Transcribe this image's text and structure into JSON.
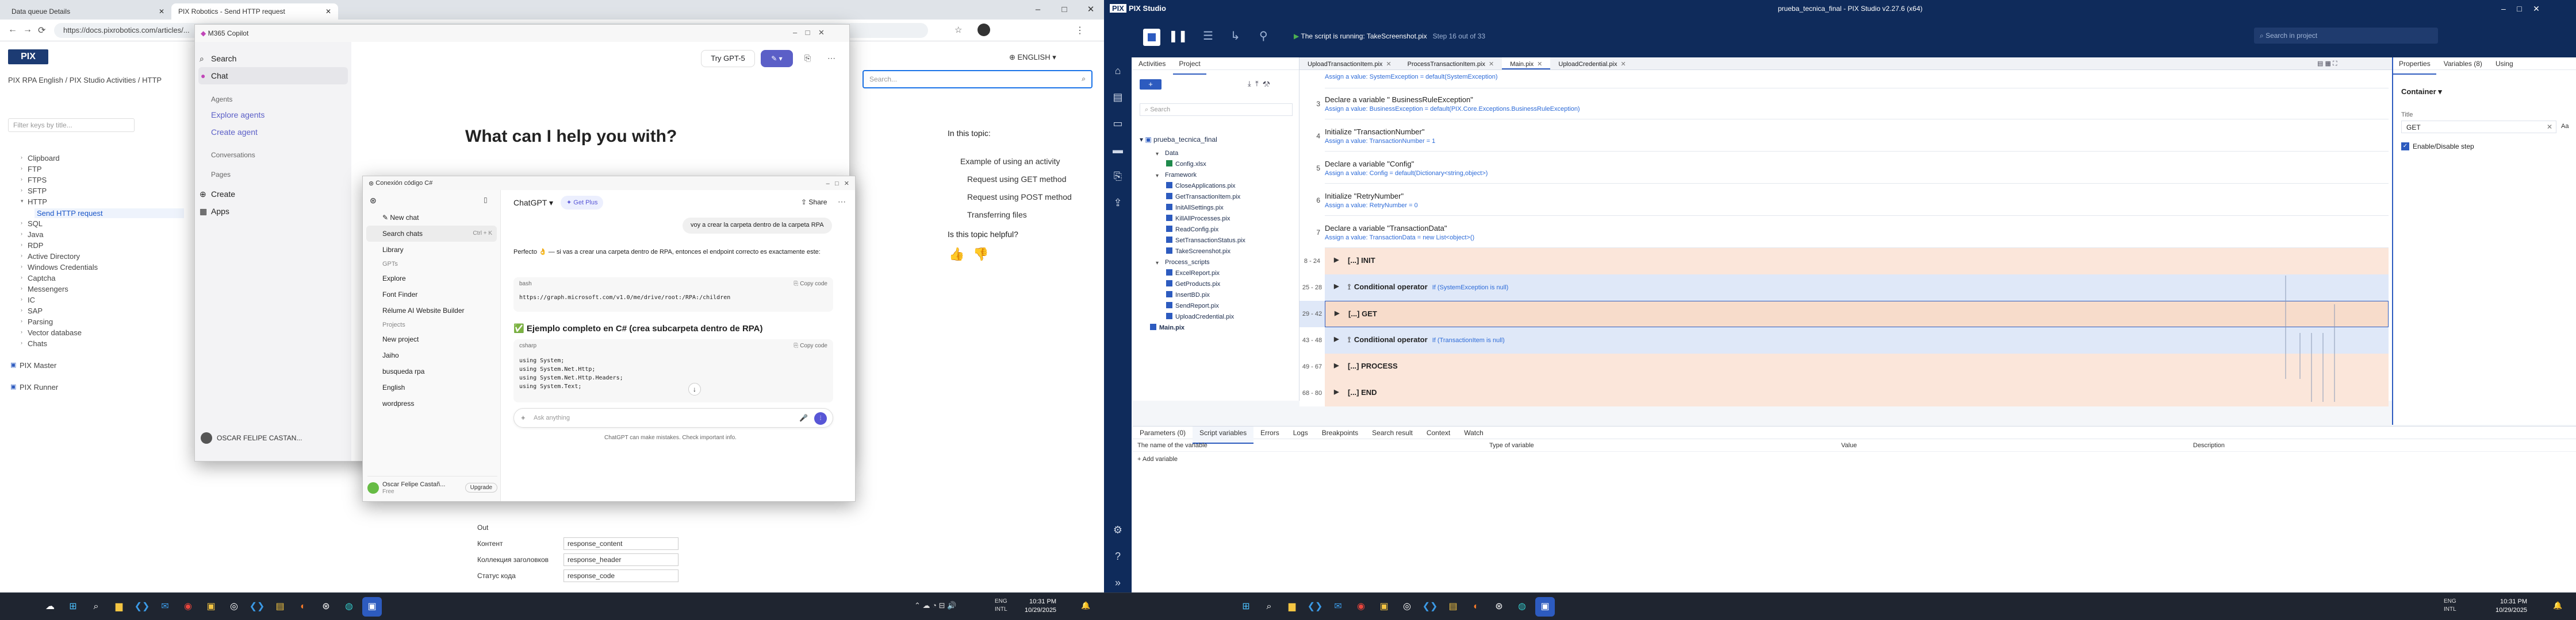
{
  "browser": {
    "tabs": [
      {
        "label": "Data queue Details"
      },
      {
        "label": "PIX Robotics - Send HTTP request"
      }
    ],
    "url": "https://docs.pixrobotics.com/articles/...",
    "window_controls": [
      "–",
      "□",
      "✕"
    ]
  },
  "docs": {
    "breadcrumb": "PIX RPA English / PIX Studio Activities / HTTP",
    "filter_placeholder": "Filter keys by title...",
    "nav_items": [
      "Clipboard",
      "FTP",
      "FTPS",
      "SFTP",
      "HTTP",
      "Send HTTP request",
      "SQL",
      "Java",
      "RDP",
      "Active Directory",
      "Windows Credentials",
      "Captcha",
      "Messengers",
      "IC",
      "SAP",
      "Parsing",
      "Vector database",
      "Chats",
      "PIX Master",
      "PIX Runner"
    ],
    "language": "ENGLISH",
    "search_placeholder": "Search...",
    "topics_title": "In this topic:",
    "topics": [
      "Example of using an activity",
      "Request using GET method",
      "Request using POST method",
      "Transferring files"
    ],
    "helpful": "Is this topic helpful?",
    "props": [
      {
        "label": "Out",
        "value": ""
      },
      {
        "label": "Контент",
        "value": "response_content"
      },
      {
        "label": "Коллекция заголовков",
        "value": "response_header"
      },
      {
        "label": "Статус кода",
        "value": "response_code"
      }
    ]
  },
  "copilot": {
    "title": "M365 Copilot",
    "menu": [
      "Search",
      "Chat",
      "Agents",
      "Explore agents",
      "Create agent",
      "Conversations",
      "Pages",
      "Create",
      "Apps"
    ],
    "try_button": "Try GPT-5",
    "heading": "What can I help you with?",
    "user": "OSCAR FELIPE CASTAN..."
  },
  "chatgpt": {
    "window_title": "Conexión código C#",
    "model": "ChatGPT",
    "plus": "Get Plus",
    "share": "Share",
    "side": [
      "New chat",
      "Search chats",
      "Library",
      "GPTs",
      "Explore",
      "Font Finder",
      "Rélume AI Website Builder",
      "Projects",
      "New project",
      "Jaiho",
      "busqueda rpa",
      "English",
      "wordpress"
    ],
    "search_hint": "Ctrl + K",
    "user_name": "Oscar Felipe Castañ...",
    "user_plan": "Free",
    "upgrade": "Upgrade",
    "user_msg": "voy a crear la carpeta dentro de la carpeta RPA",
    "reply_1": "Perfecto 👌 — si vas a crear una carpeta dentro de RPA, entonces el endpoint correcto es exactamente este:",
    "code_lang_1": "bash",
    "copy": "Copy code",
    "code_1": "https://graph.microsoft.com/v1.0/me/drive/root:/RPA:/children",
    "section": "✅ Ejemplo completo en C# (crea subcarpeta dentro de RPA)",
    "code_lang_2": "csharp",
    "code_2": [
      "using System;",
      "using System.Net.Http;",
      "using System.Net.Http.Headers;",
      "using System.Text;"
    ],
    "placeholder": "Ask anything",
    "disclaimer": "ChatGPT can make mistakes. Check important info."
  },
  "taskbar_left": {
    "time": "10:31 PM",
    "date": "10/29/2025",
    "lang": "ENG INTL"
  },
  "pix": {
    "app_title": "prueba_tecnica_final - PIX Studio v2.27.6 (x64)",
    "brand": "PIX Studio",
    "status": "The script is running: TakeScreenshot.pix",
    "step": "Step 16 out of 33",
    "search_project": "Search in project",
    "panel_tabs": [
      "Activities",
      "Project"
    ],
    "search": "Search",
    "project_name": "prueba_tecnica_final",
    "tree": [
      {
        "name": "Data",
        "kind": "folder"
      },
      {
        "name": "Config.xlsx",
        "kind": "xlsx"
      },
      {
        "name": "Framework",
        "kind": "folder"
      },
      {
        "name": "CloseApplications.pix",
        "kind": "pix"
      },
      {
        "name": "GetTransactionItem.pix",
        "kind": "pix"
      },
      {
        "name": "InitAllSettings.pix",
        "kind": "pix"
      },
      {
        "name": "KillAllProcesses.pix",
        "kind": "pix"
      },
      {
        "name": "ReadConfig.pix",
        "kind": "pix"
      },
      {
        "name": "SetTransactionStatus.pix",
        "kind": "pix"
      },
      {
        "name": "TakeScreenshot.pix",
        "kind": "pix"
      },
      {
        "name": "Process_scripts",
        "kind": "folder"
      },
      {
        "name": "ExcelReport.pix",
        "kind": "pix"
      },
      {
        "name": "GetProducts.pix",
        "kind": "pix"
      },
      {
        "name": "InsertBD.pix",
        "kind": "pix"
      },
      {
        "name": "SendReport.pix",
        "kind": "pix"
      },
      {
        "name": "UploadCredential.pix",
        "kind": "pix"
      },
      {
        "name": "Main.pix",
        "kind": "pix"
      }
    ],
    "doc_tabs": [
      "UploadTransactionItem.pix",
      "ProcessTransactionItem.pix",
      "Main.pix",
      "UploadCredential.pix"
    ],
    "steps": [
      {
        "line": "",
        "title": "",
        "sub": "Assign a value: SystemException = default(SystemException)"
      },
      {
        "line": "3",
        "title": "Declare a variable \" BusinessRuleException\"",
        "sub": "Assign a value: BusinessException = default(PIX.Core.Exceptions.BusinessRuleException)"
      },
      {
        "line": "4",
        "title": "Initialize \"TransactionNumber\"",
        "sub": "Assign a value: TransactionNumber = 1"
      },
      {
        "line": "5",
        "title": "Declare a variable \"Config\"",
        "sub": "Assign a value: Config = default(Dictionary<string,object>)"
      },
      {
        "line": "6",
        "title": "Initialize \"RetryNumber\"",
        "sub": "Assign a value: RetryNumber = 0"
      },
      {
        "line": "7",
        "title": "Declare a variable \"TransactionData\"",
        "sub": "Assign a value: TransactionData = new List<object>()"
      }
    ],
    "blocks": [
      {
        "lines": "8 - 24",
        "label": "[...] INIT",
        "cond": ""
      },
      {
        "lines": "25 - 28",
        "label": "Conditional operator",
        "cond": "If (SystemException is null)"
      },
      {
        "lines": "29 - 42",
        "label": "[...] GET",
        "cond": ""
      },
      {
        "lines": "43 - 48",
        "label": "Conditional operator",
        "cond": "If (TransactionItem is null)"
      },
      {
        "lines": "49 - 67",
        "label": "[...] PROCESS",
        "cond": ""
      },
      {
        "lines": "68 - 80",
        "label": "[...] END",
        "cond": ""
      }
    ],
    "right_tabs": [
      "Properties",
      "Variables (8)",
      "Using"
    ],
    "container": "Container",
    "title_label": "Title",
    "title_value": "GET",
    "enable_label": "Enable/Disable step",
    "bottom_tabs": [
      "Parameters (0)",
      "Script variables",
      "Errors",
      "Logs",
      "Breakpoints",
      "Search result",
      "Context",
      "Watch"
    ],
    "var_headers": [
      "The name of the variable",
      "Type of variable",
      "Value",
      "Description"
    ],
    "add_var": "+ Add variable"
  },
  "taskbar_right": {
    "time": "10:31 PM",
    "date": "10/29/2025",
    "lang": "ENG INTL"
  }
}
